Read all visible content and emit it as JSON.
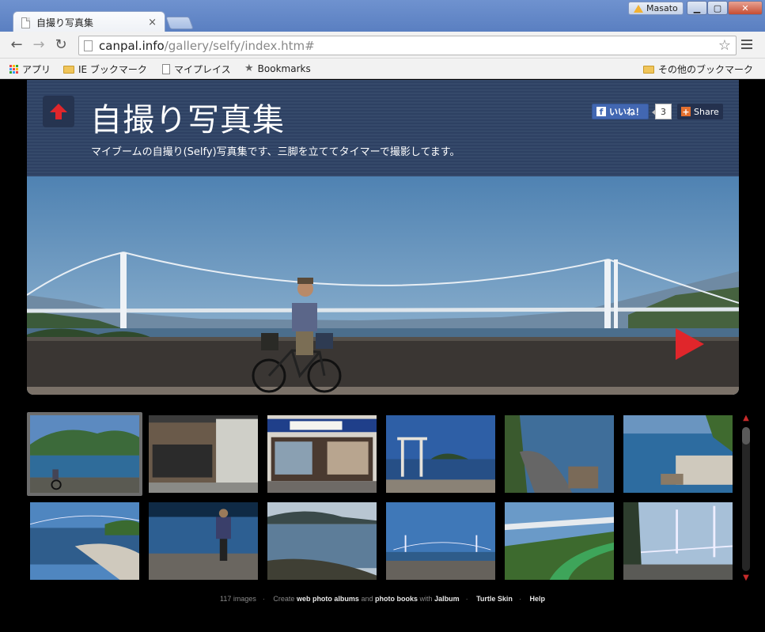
{
  "browser": {
    "tab_title": "自撮り写真集",
    "tab_close": "×",
    "user_name": "Masato",
    "url_host": "canpal.info",
    "url_path": "/gallery/selfy/index.htm#",
    "bookmarks": {
      "apps": "アプリ",
      "ie": "IE ブックマーク",
      "places": "マイプレイス",
      "bookmarks": "Bookmarks",
      "other": "その他のブックマーク"
    }
  },
  "gallery": {
    "title": "自撮り写真集",
    "subtitle": "マイブームの自撮り(Selfy)写真集です、三脚を立ててタイマーで撮影してます。",
    "facebook": {
      "like": "いいね！",
      "count": "3",
      "share": "Share"
    }
  },
  "thumbnails": [
    {
      "scene": "coast-bike",
      "selected": true
    },
    {
      "scene": "shops"
    },
    {
      "scene": "shopfront"
    },
    {
      "scene": "torii"
    },
    {
      "scene": "cliff-road"
    },
    {
      "scene": "breakwater"
    },
    {
      "scene": "bay-bridge"
    },
    {
      "scene": "rider-back"
    },
    {
      "scene": "calm-sea"
    },
    {
      "scene": "bridge-far"
    },
    {
      "scene": "cycle-lane"
    },
    {
      "scene": "bridge-road"
    }
  ],
  "footer": {
    "count": "117 images",
    "create": "Create",
    "albums": "web photo albums",
    "and": "and",
    "books": "photo books",
    "with": "with",
    "jalbum": "Jalbum",
    "skin": "Turtle Skin",
    "help": "Help"
  },
  "colors": {
    "accent_red": "#e0262b",
    "header_blue": "#33476a"
  }
}
